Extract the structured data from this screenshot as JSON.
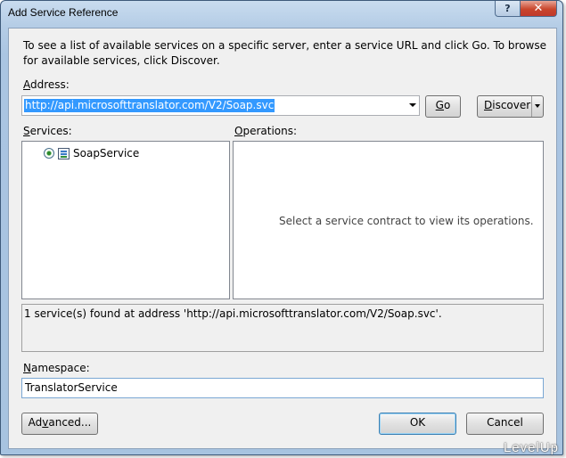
{
  "window": {
    "title": "Add Service Reference",
    "help_label": "?",
    "close_label": "✕"
  },
  "intro_text": "To see a list of available services on a specific server, enter a service URL and click Go. To browse for available services, click Discover.",
  "address": {
    "label_underlined": "A",
    "label_rest": "ddress:",
    "value": "http://api.microsofttranslator.com/V2/Soap.svc"
  },
  "buttons": {
    "go_underlined": "G",
    "go_rest": "o",
    "discover_underlined": "D",
    "discover_rest": "iscover",
    "advanced_prefix": "Ad",
    "advanced_underlined": "v",
    "advanced_rest": "anced...",
    "ok": "OK",
    "cancel": "Cancel"
  },
  "services": {
    "label_underlined": "S",
    "label_rest": "ervices:",
    "items": [
      "SoapService"
    ]
  },
  "operations": {
    "label_underlined": "O",
    "label_rest": "perations:",
    "empty_message": "Select a service contract to view its operations."
  },
  "status_text": "1 service(s) found at address 'http://api.microsofttranslator.com/V2/Soap.svc'.",
  "namespace": {
    "label_underlined": "N",
    "label_rest": "amespace:",
    "value": "TranslatorService"
  },
  "watermark": "LevelUp"
}
